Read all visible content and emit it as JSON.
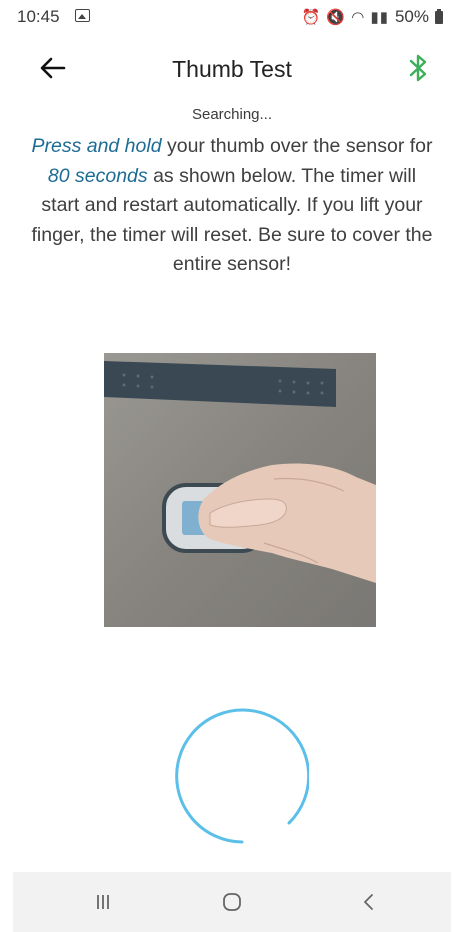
{
  "status_bar": {
    "time": "10:45",
    "battery": "50%",
    "icons": [
      "image-icon",
      "alarm-icon",
      "mute-icon",
      "wifi-icon",
      "signal-icon",
      "signal-icon",
      "battery-icon"
    ]
  },
  "app_bar": {
    "title": "Thumb Test",
    "back_icon": "arrow-left-icon",
    "bluetooth_icon": "bluetooth-icon",
    "bluetooth_color": "#3dae5a"
  },
  "instructions": {
    "status": "Searching...",
    "part1_em": "Press and hold",
    "part2": " your thumb over the sensor for ",
    "part3_em": "80 seconds",
    "part4": " as shown below. The timer will start and restart automatically. If you lift your finger, the timer will reset. Be sure to cover the entire sensor!",
    "emphasis_color": "#1d6c94"
  },
  "spinner": {
    "color": "#5bbfe8"
  },
  "nav_bar": {
    "recent_icon": "recent-apps-icon",
    "home_icon": "home-icon",
    "back_icon": "back-icon"
  }
}
